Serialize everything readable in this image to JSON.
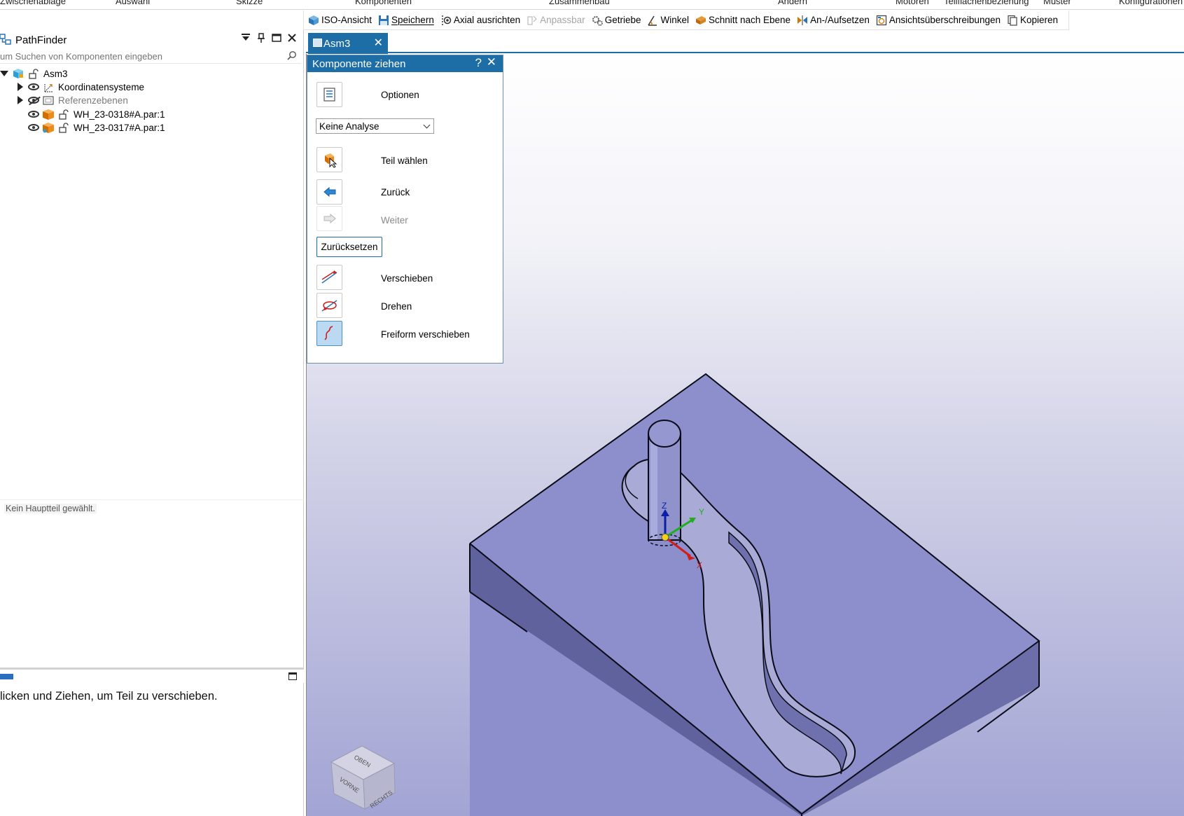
{
  "ribbon_groups": [
    "Zwischenablage",
    "Auswahl",
    "Skizze",
    "Komponenten",
    "Zusammenbau",
    "Ändern",
    "Motoren",
    "Teilflächenbeziehung",
    "Muster",
    "Konfigurationen"
  ],
  "quick_toolbar": {
    "iso_view": "ISO-Ansicht",
    "save": "Speichern",
    "axial_align": "Axial ausrichten",
    "adjustable": "Anpassbar",
    "gears": "Getriebe",
    "angle": "Winkel",
    "section_by_plane": "Schnitt nach Ebene",
    "mate": "An-/Aufsetzen",
    "view_overrides": "Ansichtsüberschreibungen",
    "copy": "Kopieren"
  },
  "pathfinder": {
    "title": "PathFinder",
    "search_placeholder": "um Suchen von Komponenten eingeben",
    "tree": [
      {
        "label": "Asm3"
      },
      {
        "label": "Koordinatensysteme"
      },
      {
        "label": "Referenzebenen"
      },
      {
        "label": "WH_23-0318#A.par:1"
      },
      {
        "label": "WH_23-0317#A.par:1"
      }
    ],
    "status": "Kein Hauptteil gewählt.",
    "prompt": "licken und Ziehen, um Teil zu verschieben."
  },
  "document": {
    "tab_label": "Asm3"
  },
  "dialog": {
    "title": "Komponente ziehen",
    "help": "?",
    "options_label": "Optionen",
    "analysis_value": "Keine Analyse",
    "select_part_label": "Teil wählen",
    "back_label": "Zurück",
    "next_label": "Weiter",
    "reset_label": "Zurücksetzen",
    "move_label": "Verschieben",
    "rotate_label": "Drehen",
    "freeform_label": "Freiform verschieben"
  },
  "triad": {
    "z": "Z",
    "y": "Y",
    "x": "X"
  },
  "viewcube": {
    "top": "OBEN",
    "front": "VORNE",
    "right": "RECHTS"
  },
  "colors": {
    "accent": "#1d6ea6",
    "part": "#8f93cc"
  }
}
